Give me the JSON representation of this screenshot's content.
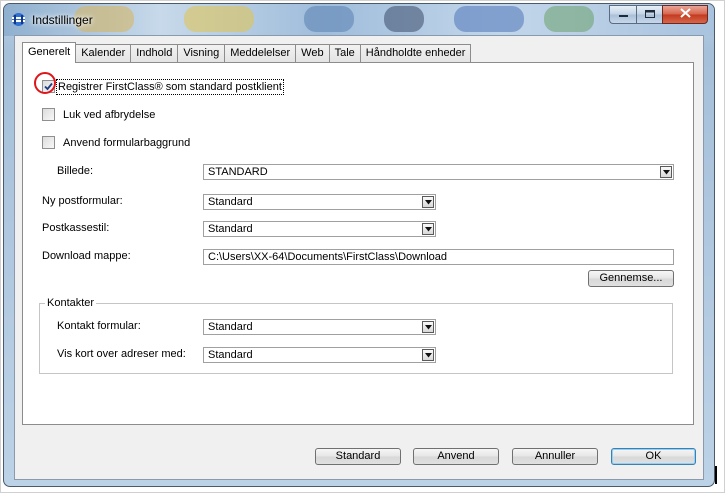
{
  "window": {
    "title": "Indstillinger",
    "icons": {
      "app": "firstclass-app-icon",
      "minimize": "minimize-icon",
      "maximize": "maximize-icon",
      "close": "close-icon"
    }
  },
  "tabs": [
    {
      "label": "Generelt",
      "active": true
    },
    {
      "label": "Kalender",
      "active": false
    },
    {
      "label": "Indhold",
      "active": false
    },
    {
      "label": "Visning",
      "active": false
    },
    {
      "label": "Meddelelser",
      "active": false
    },
    {
      "label": "Web",
      "active": false
    },
    {
      "label": "Tale",
      "active": false
    },
    {
      "label": "Håndholdte enheder",
      "active": false
    }
  ],
  "general": {
    "register_default": {
      "label": "Registrer FirstClass® som standard postklient",
      "checked": true
    },
    "close_on_disconnect": {
      "label": "Luk ved afbrydelse",
      "checked": false
    },
    "use_form_background": {
      "label": "Anvend formularbaggrund",
      "checked": false
    },
    "picture": {
      "label": "Billede:",
      "value": "STANDARD"
    },
    "new_mail_form": {
      "label": "Ny postformular:",
      "value": "Standard"
    },
    "mailbox_style": {
      "label": "Postkassestil:",
      "value": "Standard"
    },
    "download_folder": {
      "label": "Download mappe:",
      "value": "C:\\Users\\XX-64\\Documents\\FirstClass\\Download"
    },
    "browse_button": "Gennemse..."
  },
  "contacts": {
    "title": "Kontakter",
    "contact_form": {
      "label": "Kontakt formular:",
      "value": "Standard"
    },
    "address_card": {
      "label": "Vis kort over adreser med:",
      "value": "Standard"
    }
  },
  "footer": {
    "standard": "Standard",
    "apply": "Anvend",
    "cancel": "Annuller",
    "ok": "OK"
  },
  "colors": {
    "highlight_circle": "#e0151a",
    "default_button_border": "#3c7fb1"
  }
}
